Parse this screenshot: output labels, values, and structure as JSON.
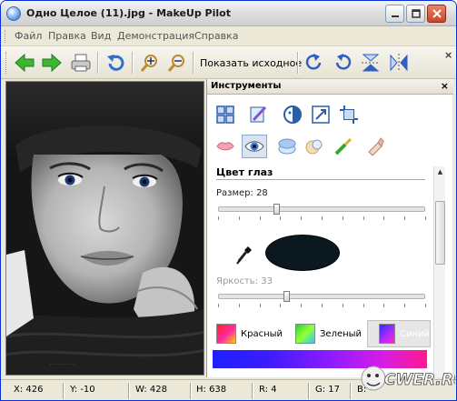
{
  "window": {
    "title": "Одно Целое (11).jpg - MakeUp Pilot"
  },
  "menu": {
    "items": [
      "Файл",
      "Правка",
      "Вид",
      "Демонстрация",
      "Справка"
    ]
  },
  "toolbar": {
    "show_original_label": "Показать исходное",
    "icons": [
      "back-arrow-icon",
      "forward-arrow-icon",
      "print-icon",
      "undo-icon",
      "zoom-in-icon",
      "zoom-out-icon",
      "rotate-right-icon",
      "rotate-left-icon",
      "flip-vertical-icon",
      "flip-horizontal-icon"
    ]
  },
  "panel": {
    "title": "Инструменты",
    "section_title": "Цвет глаз",
    "size_label": "Размер: 28",
    "size_value": 28,
    "brightness_label": "Яркость: 33",
    "brightness_value": 33,
    "eye_color": "#0c1820",
    "colors": [
      {
        "label": "Красный"
      },
      {
        "label": "Зеленый"
      },
      {
        "label": "Синий",
        "selected": true
      }
    ]
  },
  "status": {
    "x": "X: 426",
    "y": "Y: -10",
    "w": "W: 428",
    "h": "H: 638",
    "r": "R: 4",
    "g": "G: 17",
    "b": "B: "
  },
  "watermark": "CWER.RU"
}
